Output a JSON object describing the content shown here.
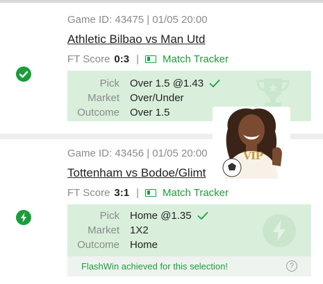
{
  "games": [
    {
      "meta": "Game ID: 43475 | 01/05 20:00",
      "match": "Athletic Bilbao vs Man Utd",
      "ft_label": "FT Score",
      "ft_score": "0:3",
      "separator": "|",
      "tracker_label": "Match Tracker",
      "status_icon": "check-circle-icon",
      "rows": [
        {
          "label": "Pick",
          "value": "Over 1.5 @1.43"
        },
        {
          "label": "Market",
          "value": "Over/Under"
        },
        {
          "label": "Outcome",
          "value": "Over 1.5"
        }
      ]
    },
    {
      "meta": "Game ID: 43456 | 01/05 20:00",
      "match": "Tottenham vs Bodoe/Glimt",
      "ft_label": "FT Score",
      "ft_score": "3:1",
      "separator": "|",
      "tracker_label": "Match Tracker",
      "status_icon": "lightning-circle-icon",
      "rows": [
        {
          "label": "Pick",
          "value": "Home @1.35"
        },
        {
          "label": "Market",
          "value": "1X2"
        },
        {
          "label": "Outcome",
          "value": "Home"
        }
      ],
      "flash_message": "FlashWin achieved for this selection!"
    }
  ],
  "vip_promo": {
    "badge": "VIP"
  },
  "colors": {
    "accent": "#1a9e3a",
    "pick_bg": "#d9efdc",
    "muted": "#8a8a8a"
  }
}
